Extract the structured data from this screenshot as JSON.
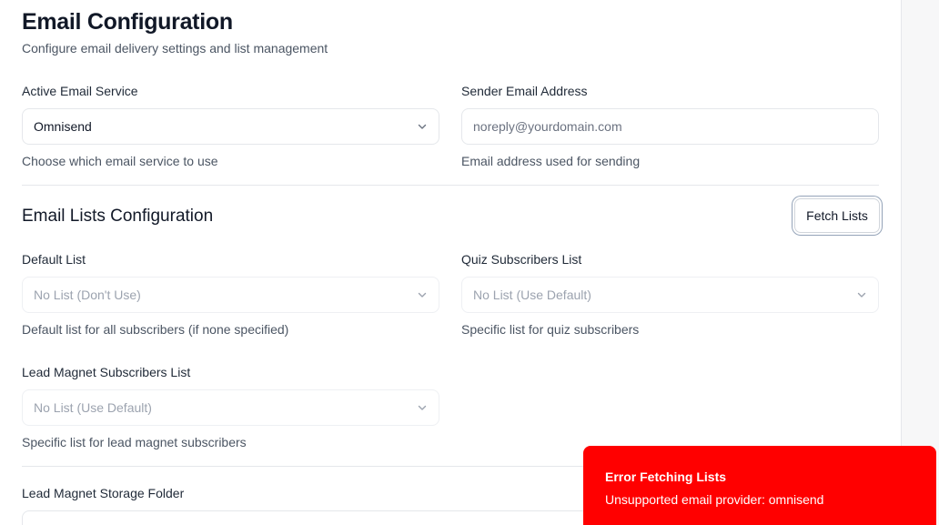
{
  "header": {
    "title": "Email Configuration",
    "subtitle": "Configure email delivery settings and list management"
  },
  "service": {
    "label": "Active Email Service",
    "selected": "Omnisend",
    "help": "Choose which email service to use"
  },
  "sender": {
    "label": "Sender Email Address",
    "placeholder": "noreply@yourdomain.com",
    "help": "Email address used for sending"
  },
  "lists": {
    "title": "Email Lists Configuration",
    "fetch_label": "Fetch Lists",
    "default_list": {
      "label": "Default List",
      "selected": "No List (Don't Use)",
      "help": "Default list for all subscribers (if none specified)"
    },
    "quiz_list": {
      "label": "Quiz Subscribers List",
      "selected": "No List (Use Default)",
      "help": "Specific list for quiz subscribers"
    },
    "lead_list": {
      "label": "Lead Magnet Subscribers List",
      "selected": "No List (Use Default)",
      "help": "Specific list for lead magnet subscribers"
    }
  },
  "storage": {
    "label": "Lead Magnet Storage Folder"
  },
  "toast": {
    "title": "Error Fetching Lists",
    "message": "Unsupported email provider: omnisend",
    "color": "#ff0000"
  },
  "icons": {
    "select_chevron": "chevron-down-icon"
  }
}
